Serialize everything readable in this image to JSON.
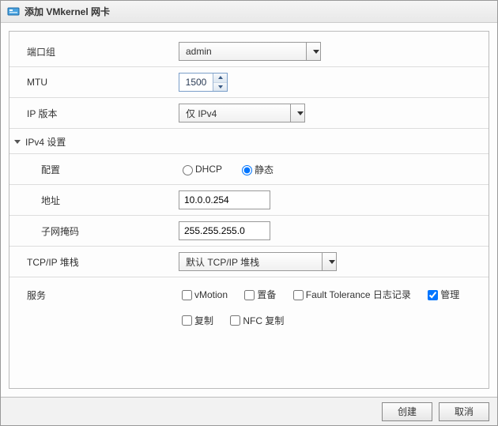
{
  "title": "添加 VMkernel 网卡",
  "labels": {
    "port_group": "端口组",
    "mtu": "MTU",
    "ip_version": "IP 版本",
    "ipv4_settings": "IPv4 设置",
    "config": "配置",
    "address": "地址",
    "subnet_mask": "子网掩码",
    "tcpip_stack": "TCP/IP 堆栈",
    "services": "服务"
  },
  "port_group": {
    "selected": "admin"
  },
  "mtu": {
    "value": "1500"
  },
  "ip_version": {
    "selected": "仅 IPv4"
  },
  "ipv4": {
    "config_mode": "static",
    "dhcp_label": "DHCP",
    "static_label": "静态",
    "address": "10.0.0.254",
    "subnet_mask": "255.255.255.0"
  },
  "tcpip_stack": {
    "selected": "默认 TCP/IP 堆栈"
  },
  "services": {
    "vmotion": {
      "label": "vMotion",
      "checked": false
    },
    "provisioning": {
      "label": "置备",
      "checked": false
    },
    "ft_logging": {
      "label": "Fault Tolerance 日志记录",
      "checked": false
    },
    "management": {
      "label": "管理",
      "checked": true
    },
    "replication": {
      "label": "复制",
      "checked": false
    },
    "nfc_replication": {
      "label": "NFC 复制",
      "checked": false
    }
  },
  "buttons": {
    "create": "创建",
    "cancel": "取消"
  }
}
